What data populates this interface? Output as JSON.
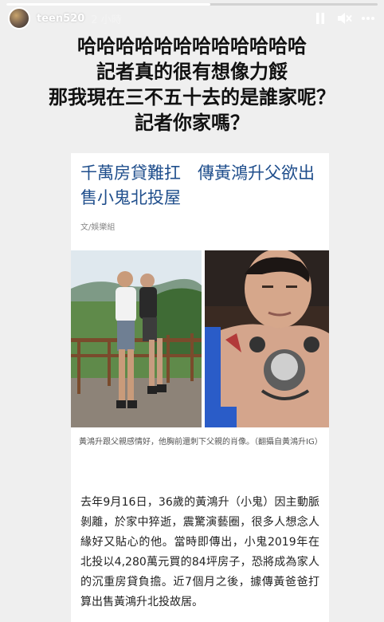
{
  "story": {
    "username": "teen520",
    "time": "2 小時"
  },
  "caption": {
    "lines": [
      "哈哈哈哈哈哈哈哈哈哈哈哈",
      "記者真的很有想像力餒",
      "那我現在三不五十去的是誰家呢？",
      "記者你家嗎？"
    ]
  },
  "article": {
    "headline": "千萬房貸難扛　傳黃鴻升父欲出售小鬼北投屋",
    "byline": "文/娛樂組",
    "photo_caption": "黃鴻升跟父親感情好，他胸前還刺下父親的肖像。（翻攝自黃鴻升IG）",
    "body": "去年9月16日，36歲的黃鴻升（小鬼）因主動脈剝離，於家中猝逝，震驚演藝圈，很多人想念人緣好又貼心的他。當時即傳出，小鬼2019年在北投以4,280萬元買的84坪房子，恐將成為家人的沉重房貸負擔。近7個月之後，據傳黃爸爸打算出售黃鴻升北投故居。"
  },
  "colors": {
    "background": "#efefef",
    "headline": "#1f4e8c"
  }
}
